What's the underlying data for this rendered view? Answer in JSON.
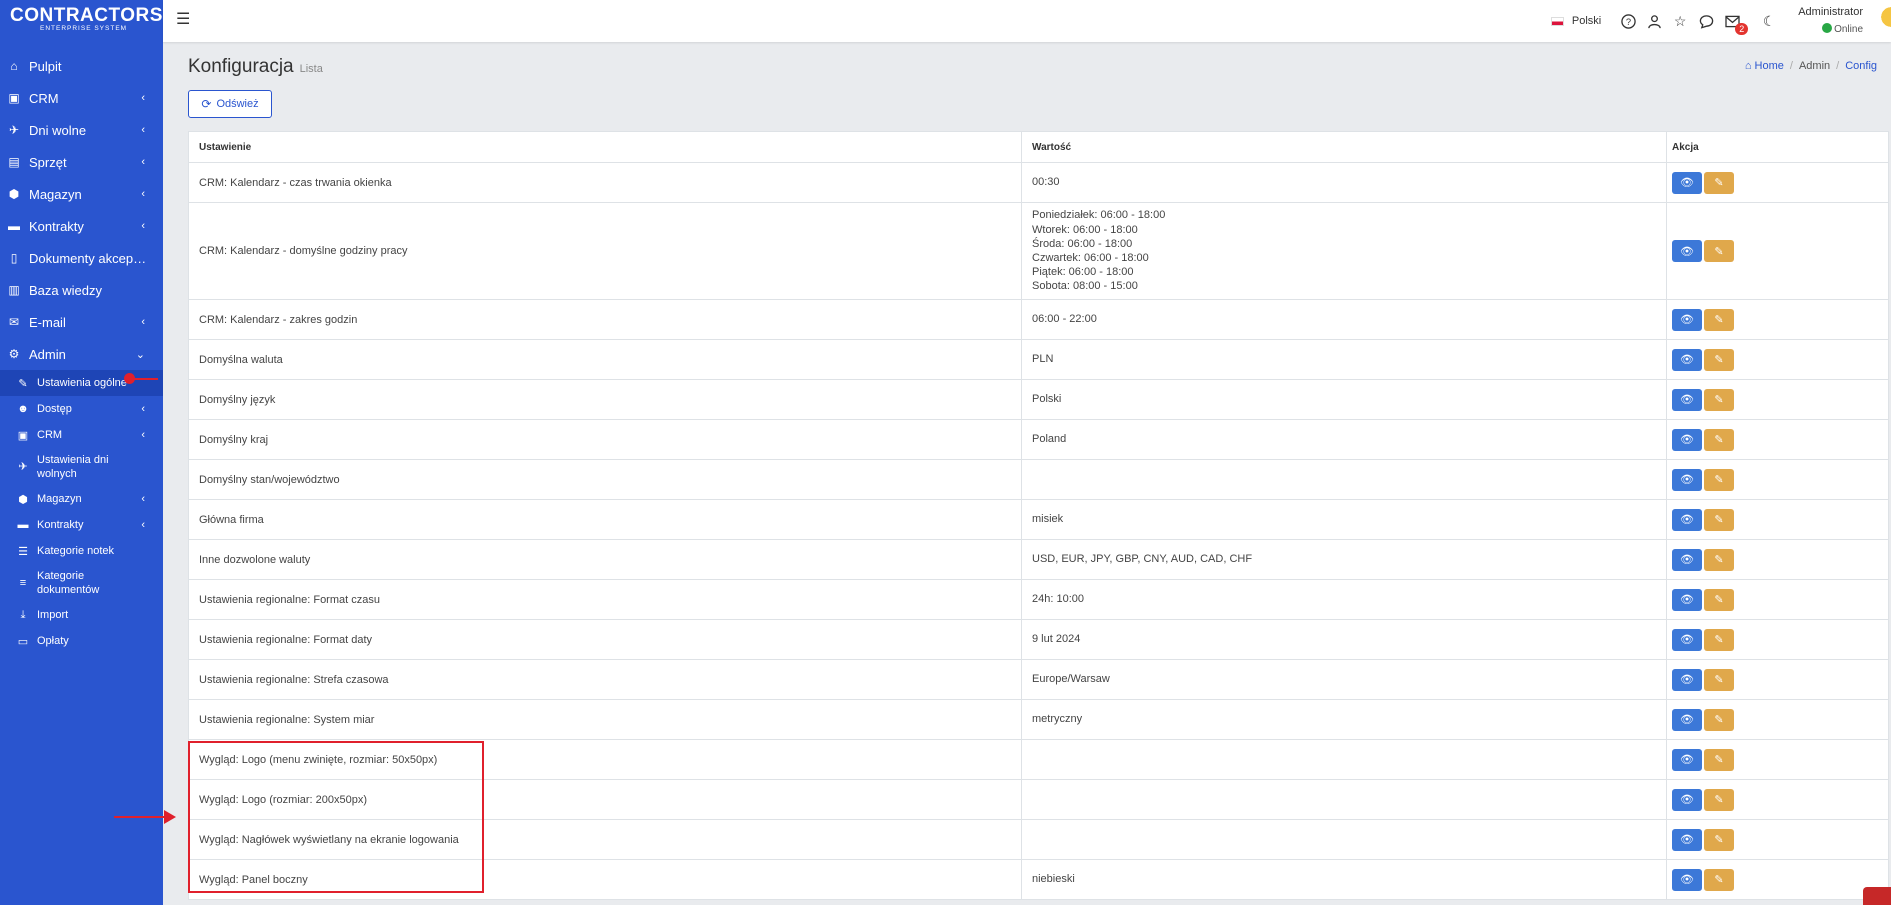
{
  "logo": {
    "main": "CONTRACTORS",
    "sub": "ENTERPRISE SYSTEM"
  },
  "sidebar": {
    "items": [
      {
        "label": "Pulpit",
        "icon": "home-icon",
        "glyph": "⌂",
        "arrow": ""
      },
      {
        "label": "CRM",
        "icon": "address-card-icon",
        "glyph": "▣",
        "arrow": "‹"
      },
      {
        "label": "Dni wolne",
        "icon": "plane-icon",
        "glyph": "✈",
        "arrow": "‹"
      },
      {
        "label": "Sprzęt",
        "icon": "hdd-icon",
        "glyph": "▤",
        "arrow": "‹"
      },
      {
        "label": "Magazyn",
        "icon": "boxes-icon",
        "glyph": "⬢",
        "arrow": "‹"
      },
      {
        "label": "Kontrakty",
        "icon": "briefcase-icon",
        "glyph": "▬",
        "arrow": "‹"
      },
      {
        "label": "Dokumenty akceptacji",
        "icon": "file-icon",
        "glyph": "▯",
        "arrow": ""
      },
      {
        "label": "Baza wiedzy",
        "icon": "book-icon",
        "glyph": "▥",
        "arrow": ""
      },
      {
        "label": "E-mail",
        "icon": "envelope-icon",
        "glyph": "✉",
        "arrow": "‹"
      },
      {
        "label": "Admin",
        "icon": "cogs-icon",
        "glyph": "⚙",
        "arrow": "⌄"
      }
    ],
    "subitems": [
      {
        "label": "Ustawienia ogólne",
        "icon": "wrench-icon",
        "glyph": "✎",
        "arrow": "",
        "active": true
      },
      {
        "label": "Dostęp",
        "icon": "users-icon",
        "glyph": "☻",
        "arrow": "‹"
      },
      {
        "label": "CRM",
        "icon": "address-card-icon",
        "glyph": "▣",
        "arrow": "‹"
      },
      {
        "label": "Ustawienia dni wolnych",
        "icon": "plane-icon",
        "glyph": "✈",
        "arrow": ""
      },
      {
        "label": "Magazyn",
        "icon": "box-icon",
        "glyph": "⬢",
        "arrow": "‹"
      },
      {
        "label": "Kontrakty",
        "icon": "briefcase-icon",
        "glyph": "▬",
        "arrow": "‹"
      },
      {
        "label": "Kategorie notek",
        "icon": "list-icon",
        "glyph": "☰",
        "arrow": ""
      },
      {
        "label": "Kategorie dokumentów",
        "icon": "bars-icon",
        "glyph": "≡",
        "arrow": ""
      },
      {
        "label": "Import",
        "icon": "download-icon",
        "glyph": "⤓",
        "arrow": ""
      },
      {
        "label": "Opłaty",
        "icon": "money-icon",
        "glyph": "▭",
        "arrow": ""
      }
    ]
  },
  "topbar": {
    "language": "Polski",
    "mail_count": "2",
    "user_name": "Administrator",
    "user_status": "Online"
  },
  "page": {
    "title": "Konfiguracja",
    "subtitle": "Lista",
    "refresh_label": "Odśwież",
    "breadcrumb": [
      "Home",
      "Admin",
      "Config"
    ]
  },
  "table": {
    "headers": [
      "Ustawienie",
      "Wartość",
      "Akcja"
    ],
    "rows": [
      {
        "setting": "CRM: Kalendarz - czas trwania okienka",
        "value": [
          "00:30"
        ]
      },
      {
        "setting": "CRM: Kalendarz - domyślne godziny pracy",
        "value": [
          "Poniedziałek: 06:00 - 18:00",
          "Wtorek: 06:00 - 18:00",
          "Środa: 06:00 - 18:00",
          "Czwartek: 06:00 - 18:00",
          "Piątek: 06:00 - 18:00",
          "Sobota: 08:00 - 15:00"
        ]
      },
      {
        "setting": "CRM: Kalendarz - zakres godzin",
        "value": [
          "06:00 - 22:00"
        ]
      },
      {
        "setting": "Domyślna waluta",
        "value": [
          "PLN"
        ]
      },
      {
        "setting": "Domyślny język",
        "value": [
          "Polski"
        ]
      },
      {
        "setting": "Domyślny kraj",
        "value": [
          "Poland"
        ]
      },
      {
        "setting": "Domyślny stan/województwo",
        "value": [
          ""
        ]
      },
      {
        "setting": "Główna firma",
        "value": [
          "misiek"
        ]
      },
      {
        "setting": "Inne dozwolone waluty",
        "value": [
          "USD, EUR, JPY, GBP, CNY, AUD, CAD, CHF"
        ]
      },
      {
        "setting": "Ustawienia regionalne: Format czasu",
        "value": [
          "24h: 10:00"
        ]
      },
      {
        "setting": "Ustawienia regionalne: Format daty",
        "value": [
          "9 lut 2024"
        ]
      },
      {
        "setting": "Ustawienia regionalne: Strefa czasowa",
        "value": [
          "Europe/Warsaw"
        ]
      },
      {
        "setting": "Ustawienia regionalne: System miar",
        "value": [
          "metryczny"
        ]
      },
      {
        "setting": "Wygląd: Logo (menu zwinięte, rozmiar: 50x50px)",
        "value": [
          ""
        ]
      },
      {
        "setting": "Wygląd: Logo (rozmiar: 200x50px)",
        "value": [
          ""
        ]
      },
      {
        "setting": "Wygląd: Nagłówek wyświetlany na ekranie logowania",
        "value": [
          ""
        ]
      },
      {
        "setting": "Wygląd: Panel boczny",
        "value": [
          "niebieski"
        ]
      }
    ]
  },
  "colors": {
    "sidebar": "#2a55cf",
    "view_button": "#3c78d8",
    "edit_button": "#e0a84b",
    "highlight": "#e0202c"
  }
}
